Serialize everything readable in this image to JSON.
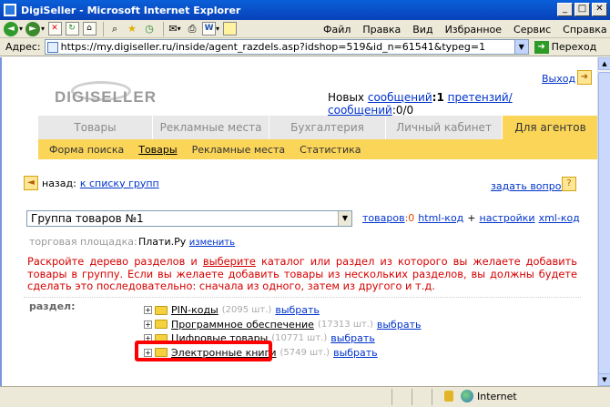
{
  "window": {
    "title": "DigiSeller - Microsoft Internet Explorer",
    "buttons": [
      "_",
      "□",
      "✕"
    ]
  },
  "menu": [
    "Файл",
    "Правка",
    "Вид",
    "Избранное",
    "Сервис",
    "Справка"
  ],
  "address": {
    "label": "Адрес:",
    "url": "https://my.digiseller.ru/inside/agent_razdels.asp?idshop=519&id_n=61541&typeg=1",
    "go_label": "Переход"
  },
  "header": {
    "logo_text": "DIGISELLER",
    "exit_label": "Выход",
    "messages_prefix": "Новых",
    "messages_link": "сообщений",
    "messages_count": ":1",
    "claims_link": "претензий/сообщений",
    "claims_count": ":0/0"
  },
  "tabs": [
    {
      "label": "Товары",
      "active": false
    },
    {
      "label": "Рекламные места",
      "active": false
    },
    {
      "label": "Бухгалтерия",
      "active": false
    },
    {
      "label": "Личный кабинет",
      "active": false
    },
    {
      "label": "Для агентов",
      "active": true
    }
  ],
  "subnav": [
    {
      "label": "Форма поиска",
      "current": false
    },
    {
      "label": "Товары",
      "current": true
    },
    {
      "label": "Рекламные места",
      "current": false
    },
    {
      "label": "Статистика",
      "current": false
    }
  ],
  "nav": {
    "back_prefix": "назад:",
    "back_link": "к списку групп",
    "ask_link": "задать вопрос"
  },
  "group": {
    "selected": "Группа товаров №1",
    "goods_link": "товаров",
    "goods_count": ":0",
    "html_link": "html-код",
    "plus": "+",
    "settings_link": "настройки",
    "xml_link": "xml-код"
  },
  "marketplace": {
    "label": "торговая площадка:",
    "value": "Плати.Ру",
    "change_link": "изменить"
  },
  "instructions": {
    "part1": "Раскройте дерево разделов и ",
    "underlined": "выберите",
    "part2": " каталог или раздел из которого вы желаете добавить товары в группу. Если вы желаете добавить товары из нескольких разделов, вы должны будете сделать это последовательно: сначала из одного, затем из другого и т.д."
  },
  "section": {
    "label": "раздел:",
    "pick_label": "выбрать",
    "items": [
      {
        "name": "PIN-коды",
        "count": "(2095 шт.)"
      },
      {
        "name": "Программное обеспечение",
        "count": "(17313 шт.)"
      },
      {
        "name": "Цифровые товары",
        "count": "(10771 шт.)"
      },
      {
        "name": "Электронные книги",
        "count": "(5749 шт.)"
      }
    ]
  },
  "status": {
    "zone": "Internet"
  },
  "colors": {
    "tab_active": "#fad558",
    "link": "#0033cc",
    "instructions": "#d60000",
    "highlight": "#ff0000"
  }
}
